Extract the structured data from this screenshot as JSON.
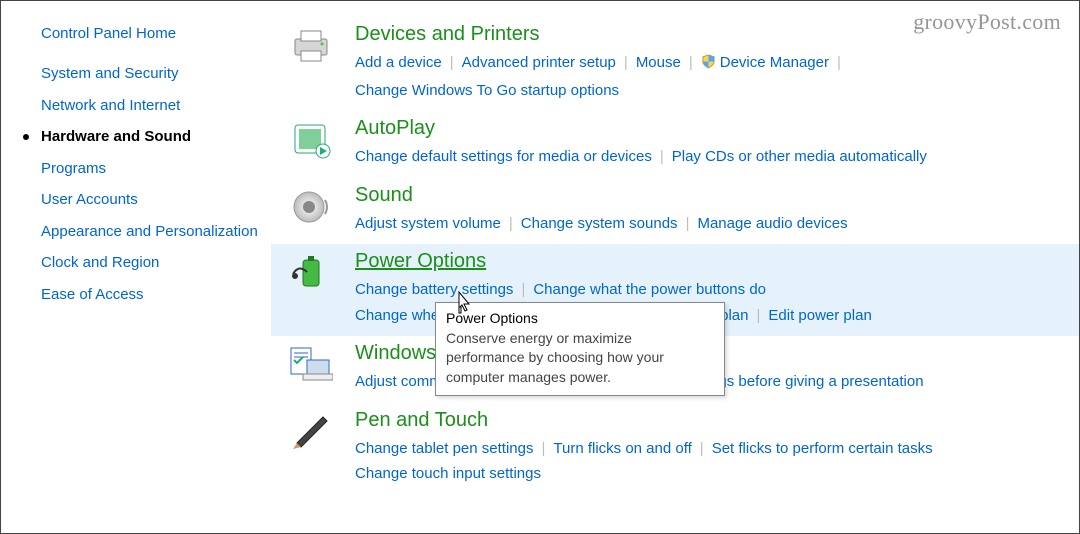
{
  "watermark": "groovyPost.com",
  "sidebar": {
    "home": "Control Panel Home",
    "items": [
      {
        "label": "System and Security"
      },
      {
        "label": "Network and Internet"
      },
      {
        "label": "Hardware and Sound",
        "active": true
      },
      {
        "label": "Programs"
      },
      {
        "label": "User Accounts"
      },
      {
        "label": "Appearance and Personalization"
      },
      {
        "label": "Clock and Region"
      },
      {
        "label": "Ease of Access"
      }
    ]
  },
  "categories": [
    {
      "icon": "printer-icon",
      "title": "Devices and Printers",
      "links": [
        "Add a device",
        "Advanced printer setup",
        "Mouse",
        {
          "shield": true,
          "label": "Device Manager"
        },
        "Change Windows To Go startup options"
      ]
    },
    {
      "icon": "autoplay-icon",
      "title": "AutoPlay",
      "links": [
        "Change default settings for media or devices",
        "Play CDs or other media automatically"
      ]
    },
    {
      "icon": "speaker-icon",
      "title": "Sound",
      "links": [
        "Adjust system volume",
        "Change system sounds",
        "Manage audio devices"
      ]
    },
    {
      "icon": "battery-icon",
      "title": "Power Options",
      "highlight": true,
      "links": [
        "Change battery settings",
        "Change what the power buttons do",
        "Change when the computer sleeps",
        "Choose a power plan",
        "Edit power plan"
      ]
    },
    {
      "icon": "laptop-icon",
      "title": "Windows Mobility Center",
      "links": [
        "Adjust commonly used mobility settings",
        "Adjust settings before giving a presentation"
      ]
    },
    {
      "icon": "pen-icon",
      "title": "Pen and Touch",
      "links": [
        "Change tablet pen settings",
        "Turn flicks on and off",
        "Set flicks to perform certain tasks",
        "Change touch input settings"
      ]
    }
  ],
  "tooltip": {
    "title": "Power Options",
    "body": "Conserve energy or maximize performance by choosing how your computer manages power."
  }
}
